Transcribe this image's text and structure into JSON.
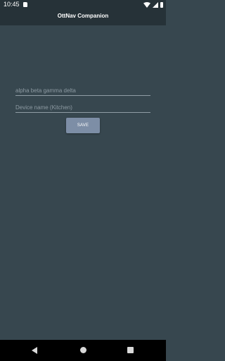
{
  "status_bar": {
    "time": "10:45",
    "icons": [
      "sd-card-icon",
      "wifi-icon",
      "signal-icon",
      "battery-icon"
    ]
  },
  "app_bar": {
    "title": "OttNav Companion"
  },
  "form": {
    "key_field": {
      "value": "",
      "placeholder": "alpha beta gamma delta"
    },
    "device_name_field": {
      "value": "",
      "placeholder": "Device name (Kitchen)"
    },
    "save_label": "SAVE"
  },
  "nav_bar": {
    "icons": [
      "back-icon",
      "home-icon",
      "recents-icon"
    ]
  },
  "colors": {
    "background": "#37474f",
    "app_bar": "#263238",
    "button": "#7d8ea6"
  }
}
